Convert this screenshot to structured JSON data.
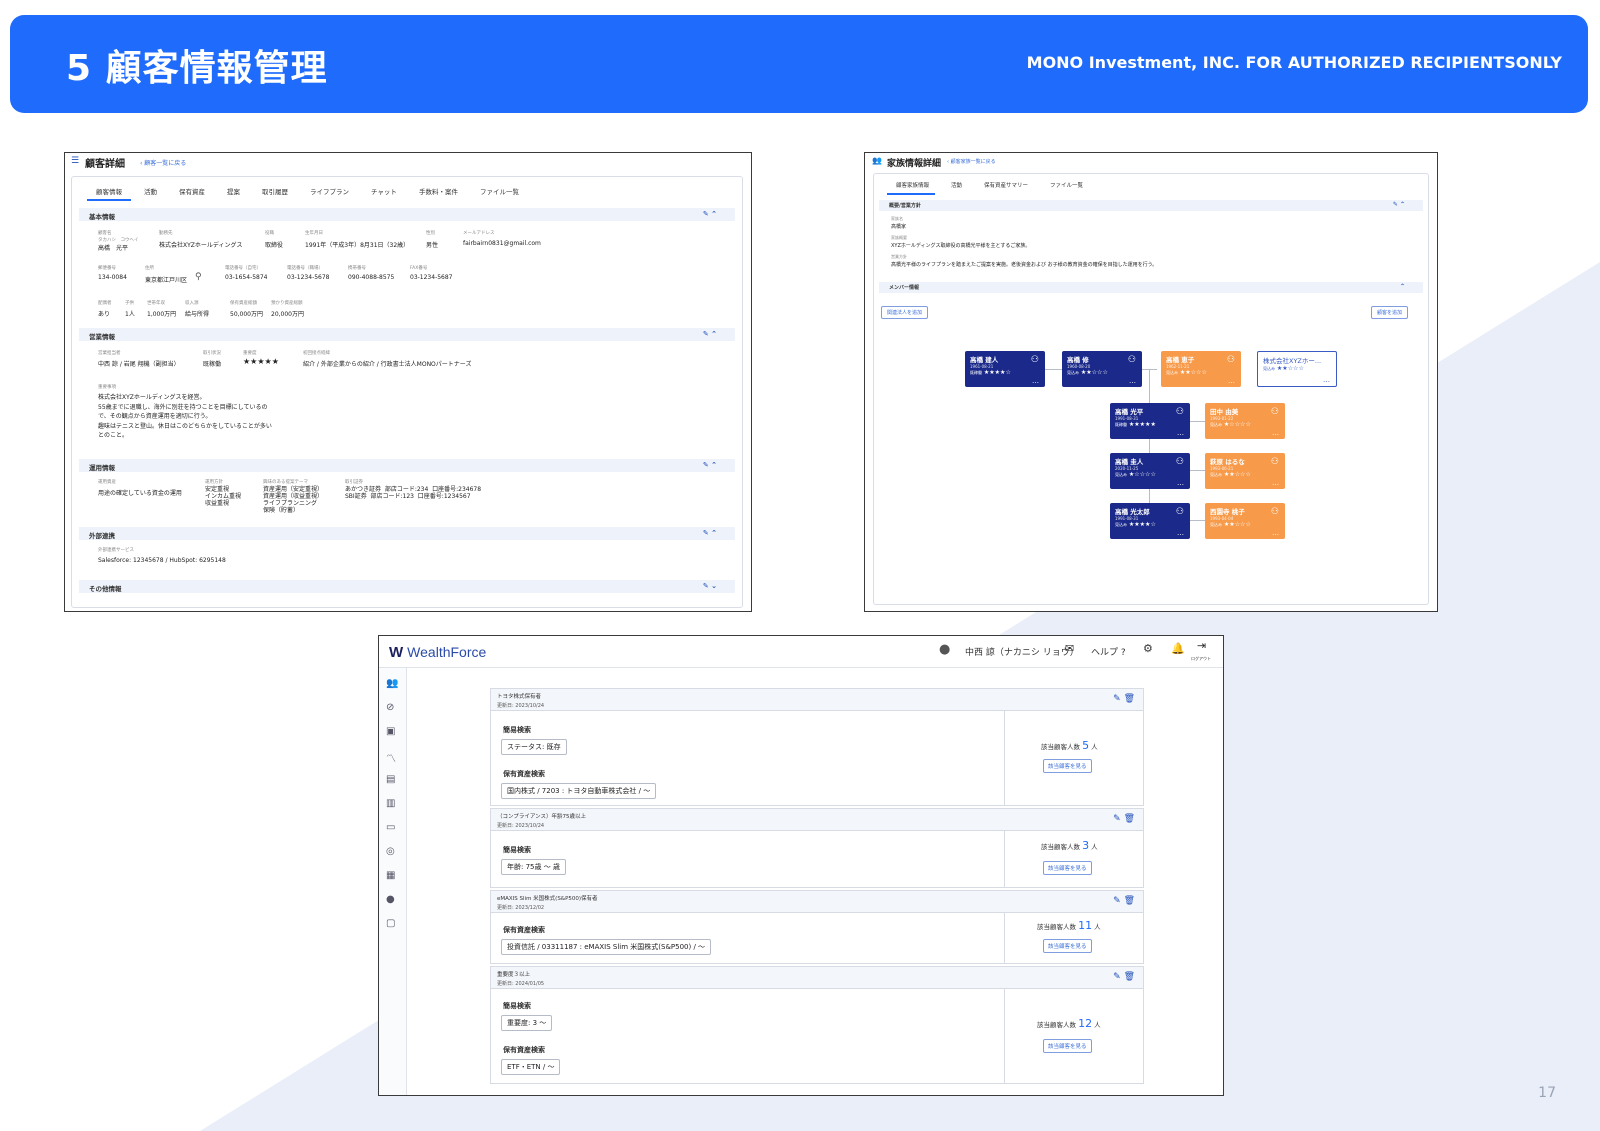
{
  "header": {
    "title": "5 顧客情報管理",
    "subtitle": "MONO Investment, INC. FOR AUTHORIZED RECIPIENTSONLY"
  },
  "page_number": "17",
  "colors": {
    "accent": "#1f6bfb",
    "navy": "#1b2a8a",
    "orange": "#f79a4a"
  },
  "customer_detail": {
    "title": "顧客詳細",
    "back_link": "‹ 顧客一覧に戻る",
    "tabs": [
      "顧客情報",
      "活動",
      "保有資産",
      "提案",
      "取引履歴",
      "ライフプラン",
      "チャット",
      "手数料・案件",
      "ファイル一覧"
    ],
    "sections": {
      "basic": "基本情報",
      "sales": "営業情報",
      "operation": "運用情報",
      "external": "外部連携",
      "other": "その他情報"
    },
    "fields": {
      "name_label": "顧客名",
      "name_kana": "タカハシ　コウヘイ",
      "name": "高橋　光平",
      "company_label": "勤務先",
      "company": "株式会社XYZホールディングス",
      "position_label": "役職",
      "position": "取締役",
      "birth_label": "生年月日",
      "birth": "1991年（平成3年）8月31日（32歳）",
      "gender_label": "性別",
      "gender": "男性",
      "email_label": "メールアドレス",
      "email": "fairbairn0831@gmail.com",
      "zip_label": "郵便番号",
      "zip": "134-0084",
      "address_label": "住所",
      "address": "東京都江戸川区",
      "tel_home_label": "電話番号（自宅）",
      "tel_home": "03-1654-5874",
      "tel_work_label": "電話番号（職場）",
      "tel_work": "03-1234-5678",
      "mobile_label": "携帯番号",
      "mobile": "090-4088-8575",
      "fax_label": "FAX番号",
      "fax": "03-1234-5687",
      "spouse_label": "配偶者",
      "spouse": "あり",
      "children_label": "子供",
      "children": "1人",
      "annual_income_label": "世帯年収",
      "annual_income": "1,000万円",
      "income_type_label": "収入源",
      "income_type": "給与所得",
      "financial_assets_label": "保有資産総額",
      "financial_assets": "50,000万円",
      "deposit_label": "預かり資産総額",
      "deposit": "20,000万円",
      "sales_rep_label": "営業担当者",
      "sales_rep": "中西 諒 / 岩尾 翔機（副担当）",
      "status_label": "取引状況",
      "status": "既稼働",
      "importance_label": "重要度",
      "importance": "★★★★★",
      "referral_label": "初回接点経緯",
      "referral": "紹介 / 外部企業からの紹介 / 行政書士法人MONOパートナーズ",
      "memo_label": "重要事項",
      "memo": "株式会社XYZホールディングスを経営。\n55歳までに退職し、海外に別荘を持つことを目標にしているの\nで、その観点から資産運用を適切に行う。\n趣味はテニスと登山。休日はこのどちらかをしていることが多い\nとのこと。",
      "fund_label": "運用資産",
      "fund": "用途の確定している資金の運用",
      "policy_label": "運用方針",
      "policy": "安定重視\nインカム重視\n収益重視",
      "theme_label": "興味のある提案テーマ",
      "theme": "資産運用（安定重視）\n資産運用（収益重視）\nライフプランニング\n保険（貯蓄）",
      "account_label": "取引証券",
      "account": "あかつき証券  部店コード:234  口座番号:234678\nSBI証券  部店コード:123  口座番号:1234567",
      "ext_label": "外部連携サービス",
      "ext": "Salesforce:  12345678  /  HubSpot:  6295148"
    }
  },
  "family_detail": {
    "title": "家族情報詳細",
    "back_link": "‹ 顧客家族一覧に戻る",
    "tabs": [
      "顧客家族情報",
      "活動",
      "保有資産サマリー",
      "ファイル一覧"
    ],
    "section_policy": "概要/営業方針",
    "rep_label": "家族名",
    "rep": "高橋家",
    "summary_label": "家族概要",
    "summary": "XYZホールディングス取締役の高橋光平様を主とするご家族。",
    "policy_label": "営業方針",
    "policy": "高橋光平様のライフプランを踏まえたご提案を実施。老後資金および お子様の教育資金の確保を目指した運用を行う。",
    "section_members": "メンバー情報",
    "add_related_button": "関連法人を追加",
    "add_member_button": "顧客を追加",
    "members": [
      {
        "name": "高橋 建人",
        "date": "1961-08-21",
        "rank": "★★★★☆",
        "status": "既稼働",
        "color": "navy"
      },
      {
        "name": "高橋 修",
        "date": "1960-08-20",
        "rank": "★★☆☆☆",
        "status": "見込み",
        "color": "navy"
      },
      {
        "name": "高橋 恵子",
        "date": "1962-11-21",
        "rank": "★★☆☆☆",
        "status": "見込み",
        "color": "orange"
      },
      {
        "name": "株式会社XYZホー...",
        "date": "",
        "rank": "★★☆☆☆",
        "status": "見込み",
        "color": "white"
      },
      {
        "name": "高橋 光平",
        "date": "1991-08-31",
        "rank": "★★★★★",
        "status": "既稼働",
        "color": "navy"
      },
      {
        "name": "田中 由美",
        "date": "1993-01-22",
        "rank": "★☆☆☆☆",
        "status": "見込み",
        "color": "orange"
      },
      {
        "name": "高橋 圭人",
        "date": "2020-11-25",
        "rank": "★☆☆☆☆",
        "status": "見込み",
        "color": "navy"
      },
      {
        "name": "萩原 はるな",
        "date": "1993-06-21",
        "rank": "★★☆☆☆",
        "status": "見込み",
        "color": "orange"
      },
      {
        "name": "高橋 光太郎",
        "date": "1991-08-31",
        "rank": "★★★★☆",
        "status": "見込み",
        "color": "navy"
      },
      {
        "name": "西園寺 桃子",
        "date": "1993-04-04",
        "rank": "★★☆☆☆",
        "status": "見込み",
        "color": "orange"
      }
    ]
  },
  "wealthforce": {
    "logo": "WealthForce",
    "user": "中西 諒（ナカニシ リョウ）",
    "help": "ヘルプ",
    "logout": "ログアウト",
    "cards": [
      {
        "title": "トヨタ株式保有者",
        "updated": "更新日: 2023/10/24",
        "rows": [
          {
            "label": "簡易検索",
            "chip": "ステータス: 既存"
          },
          {
            "label": "保有資産検索",
            "chip": "国内株式 / 7203 : トヨタ自動車株式会社 / 〜"
          }
        ],
        "count_label": "該当顧客人数",
        "count": "5",
        "unit": "人",
        "button": "該当顧客を見る"
      },
      {
        "title": "（コンプライアンス）年齢75歳以上",
        "updated": "更新日: 2023/10/24",
        "rows": [
          {
            "label": "簡易検索",
            "chip": "年齢: 75歳 〜 歳"
          }
        ],
        "count_label": "該当顧客人数",
        "count": "3",
        "unit": "人",
        "button": "該当顧客を見る"
      },
      {
        "title": "eMAXIS Slim 米国株式(S&P500)保有者",
        "updated": "更新日: 2023/12/02",
        "rows": [
          {
            "label": "保有資産検索",
            "chip": "投資信託 / 03311187 : eMAXIS Slim 米国株式(S&P500) / 〜"
          }
        ],
        "count_label": "該当顧客人数",
        "count": "11",
        "unit": "人",
        "button": "該当顧客を見る"
      },
      {
        "title": "重要度３以上",
        "updated": "更新日: 2024/01/05",
        "rows": [
          {
            "label": "簡易検索",
            "chip": "重要度: 3 〜"
          },
          {
            "label": "保有資産検索",
            "chip": "ETF・ETN / 〜"
          }
        ],
        "count_label": "該当顧客人数",
        "count": "12",
        "unit": "人",
        "button": "該当顧客を見る"
      }
    ]
  }
}
